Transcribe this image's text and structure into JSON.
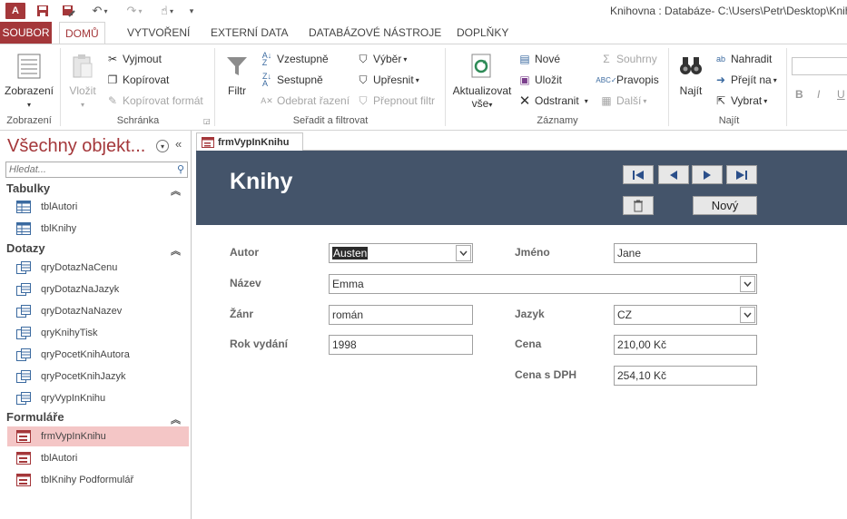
{
  "app": {
    "icon_text": "A",
    "window_title": "Knihovna : Databáze- C:\\Users\\Petr\\Desktop\\Knih"
  },
  "colors": {
    "accent": "#a4373a",
    "form_header": "#44546a",
    "selected_item": "#f4c6c6"
  },
  "tabs": [
    {
      "label": "SOUBOR"
    },
    {
      "label": "DOMŮ"
    },
    {
      "label": "VYTVOŘENÍ"
    },
    {
      "label": "EXTERNÍ DATA"
    },
    {
      "label": "DATABÁZOVÉ NÁSTROJE"
    },
    {
      "label": "DOPLŇKY"
    }
  ],
  "ribbon": {
    "zobrazeni": {
      "button": "Zobrazení",
      "group": "Zobrazení"
    },
    "schranka": {
      "vlozit": "Vložit",
      "vyjmout": "Vyjmout",
      "kopirovat": "Kopírovat",
      "kopirovat_format": "Kopírovat formát",
      "group": "Schránka"
    },
    "filtr": {
      "filtr": "Filtr",
      "vzestupne": "Vzestupně",
      "sestupne": "Sestupně",
      "odebrat": "Odebrat řazení",
      "vyber": "Výběr",
      "upresnit": "Upřesnit",
      "prepnout": "Přepnout filtr",
      "group": "Seřadit a filtrovat"
    },
    "zaznamy": {
      "aktualizovat_1": "Aktualizovat",
      "aktualizovat_2": "vše",
      "nove": "Nové",
      "ulozit": "Uložit",
      "odstranit": "Odstranit",
      "souhrny": "Souhrny",
      "pravopis": "Pravopis",
      "dalsi": "Další",
      "group": "Záznamy"
    },
    "najit": {
      "najit": "Najít",
      "nahradit": "Nahradit",
      "prejit": "Přejít na",
      "vybrat": "Vybrat",
      "group": "Najít"
    },
    "format": {
      "bold": "B",
      "italic": "I",
      "underline": "U"
    }
  },
  "nav": {
    "title": "Všechny objekt...",
    "search_placeholder": "Hledat...",
    "sections": {
      "tabulky": {
        "label": "Tabulky",
        "items": [
          "tblAutori",
          "tblKnihy"
        ]
      },
      "dotazy": {
        "label": "Dotazy",
        "items": [
          "qryDotazNaCenu",
          "qryDotazNaJazyk",
          "qryDotazNaNazev",
          "qryKnihyTisk",
          "qryPocetKnihAutora",
          "qryPocetKnihJazyk",
          "qryVypInKnihu"
        ]
      },
      "formulare": {
        "label": "Formuláře",
        "items": [
          "frmVypInKnihu",
          "tblAutori",
          "tblKnihy Podformulář"
        ]
      }
    }
  },
  "document": {
    "tab_label": "frmVypInKnihu",
    "form_title": "Knihy",
    "new_button": "Nový",
    "fields": {
      "autor": {
        "label": "Autor",
        "value": "Austen"
      },
      "jmeno": {
        "label": "Jméno",
        "value": "Jane"
      },
      "nazev": {
        "label": "Název",
        "value": "Emma"
      },
      "zanr": {
        "label": "Žánr",
        "value": "román"
      },
      "jazyk": {
        "label": "Jazyk",
        "value": "CZ"
      },
      "rok": {
        "label": "Rok vydání",
        "value": "1998"
      },
      "cena": {
        "label": "Cena",
        "value": "210,00 Kč"
      },
      "cena_dph": {
        "label": "Cena s DPH",
        "value": "254,10 Kč"
      }
    }
  }
}
